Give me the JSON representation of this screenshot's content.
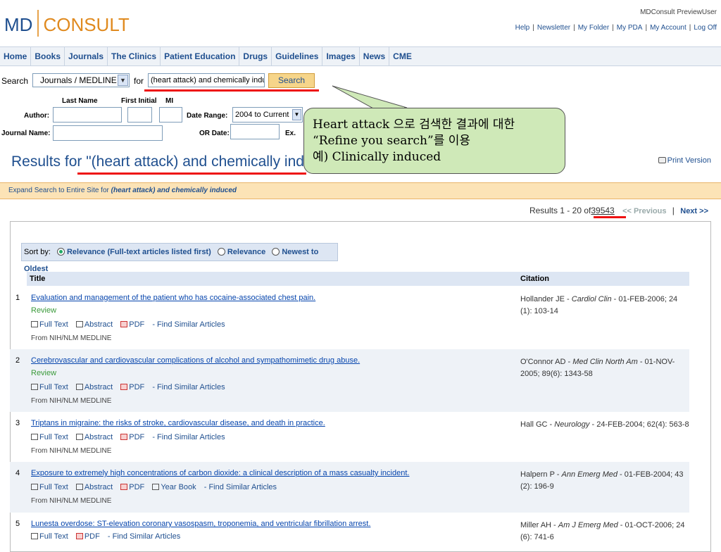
{
  "header": {
    "logo_left": "MD",
    "logo_right": "CONSULT",
    "user": "MDConsult PreviewUser",
    "links": [
      "Help",
      "Newsletter",
      "My Folder",
      "My PDA",
      "My Account",
      "Log Off"
    ]
  },
  "nav": [
    "Home",
    "Books",
    "Journals",
    "The Clinics",
    "Patient Education",
    "Drugs",
    "Guidelines",
    "Images",
    "News",
    "CME"
  ],
  "search": {
    "label": "Search",
    "scope": "Journals / MEDLINE",
    "for_label": "for",
    "query": "(heart attack) and chemically indu",
    "button": "Search"
  },
  "advanced": {
    "last_name": "Last Name",
    "first_initial": "First Initial",
    "mi": "MI",
    "author": "Author:",
    "date_range": "Date Range:",
    "date_value": "2004 to Current",
    "journal_name": "Journal Name:",
    "or_date": "OR Date:",
    "ex": "Ex."
  },
  "results_title": "Results for \"(heart attack) and chemically induced",
  "print_version": "Print Version",
  "callout": {
    "line1": "Heart attack 으로 검색한 결과에 대한",
    "line2": "“Refine you search”를 이용",
    "line3": "예) Clinically induced"
  },
  "expand": {
    "prefix": "Expand Search to Entire Site for",
    "term": "(heart attack) and chemically induced"
  },
  "pagination": {
    "results_prefix": "Results 1 - 20 o",
    "of": "f",
    "total": "39543",
    "previous": "<< Previous",
    "next": "Next >>"
  },
  "sort": {
    "label": "Sort by:",
    "options": [
      "Relevance (Full-text articles listed first)",
      "Relevance",
      "Newest to Oldest"
    ]
  },
  "columns": {
    "title": "Title",
    "citation": "Citation"
  },
  "link_labels": {
    "full_text": "Full Text",
    "abstract": "Abstract",
    "pdf": "PDF",
    "year_book": "Year Book",
    "find_similar": "- Find Similar Articles",
    "from": "From NIH/NLM MEDLINE",
    "review": "Review"
  },
  "results": [
    {
      "num": "1",
      "title": "Evaluation and management of the patient who has cocaine-associated chest pain.",
      "cite_author": "Hollander JE - ",
      "cite_journal": "Cardiol Clin",
      "cite_rest": " - 01-FEB-2006; 24 (1): 103-14"
    },
    {
      "num": "2",
      "title": "Cerebrovascular and cardiovascular complications of alcohol and sympathomimetic drug abuse.",
      "cite_author": "O'Connor AD - ",
      "cite_journal": "Med Clin North Am",
      "cite_rest": " - 01-NOV-2005; 89(6): 1343-58"
    },
    {
      "num": "3",
      "title": "Triptans in migraine: the risks of stroke, cardiovascular disease, and death in practice.",
      "cite_author": "Hall GC - ",
      "cite_journal": "Neurology",
      "cite_rest": " - 24-FEB-2004; 62(4): 563-8"
    },
    {
      "num": "4",
      "title": "Exposure to extremely high concentrations of carbon dioxide: a clinical description of a mass casualty incident.",
      "cite_author": "Halpern P - ",
      "cite_journal": "Ann Emerg Med",
      "cite_rest": " - 01-FEB-2004; 43 (2): 196-9"
    },
    {
      "num": "5",
      "title": "Lunesta overdose: ST-elevation coronary vasospasm, troponemia, and ventricular fibrillation arrest.",
      "cite_author": "Miller AH - ",
      "cite_journal": "Am J Emerg Med",
      "cite_rest": " - 01-OCT-2006; 24 (6): 741-6"
    }
  ]
}
